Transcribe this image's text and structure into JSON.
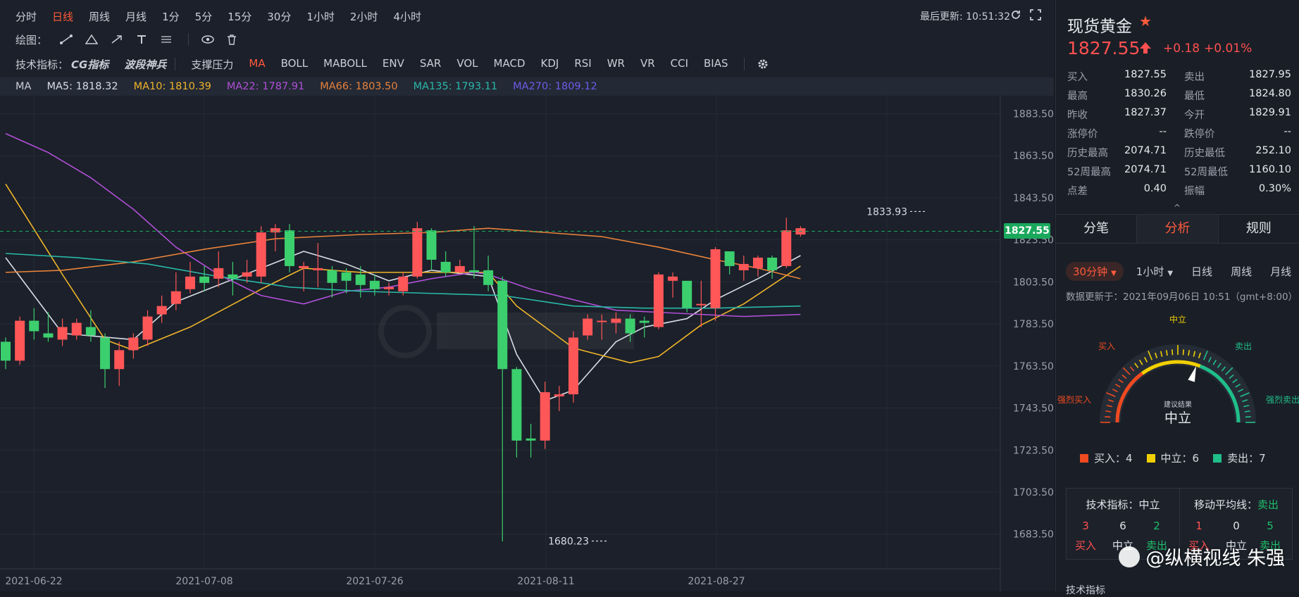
{
  "toolbar": {
    "periods": [
      "分时",
      "日线",
      "周线",
      "月线",
      "1分",
      "5分",
      "15分",
      "30分",
      "1小时",
      "2小时",
      "4小时"
    ],
    "active_period": 1,
    "last_update_label": "最后更新: 10:51:32"
  },
  "drawing": {
    "label": "绘图："
  },
  "indicators": {
    "label": "技术指标：",
    "cg": "CG指标",
    "wave": "波段神兵",
    "items": [
      "支撑压力",
      "MA",
      "BOLL",
      "MABOLL",
      "ENV",
      "SAR",
      "VOL",
      "MACD",
      "KDJ",
      "RSI",
      "WR",
      "VR",
      "CCI",
      "BIAS"
    ],
    "active": "MA"
  },
  "ma_bar": {
    "prefix": "MA",
    "items": [
      {
        "label": "MA5: 1818.32",
        "color": "#d8dde6"
      },
      {
        "label": "MA10: 1810.39",
        "color": "#f0b429"
      },
      {
        "label": "MA22: 1787.91",
        "color": "#b04fd6"
      },
      {
        "label": "MA66: 1803.50",
        "color": "#e8823a"
      },
      {
        "label": "MA135: 1793.11",
        "color": "#2ab8a8"
      },
      {
        "label": "MA270: 1809.12",
        "color": "#6c5ce7"
      }
    ]
  },
  "chart_data": {
    "type": "candlestick",
    "y_ticks": [
      "1883.50",
      "1863.50",
      "1843.50",
      "1823.50",
      "1803.50",
      "1783.50",
      "1763.50",
      "1743.50",
      "1723.50",
      "1703.50",
      "1683.50"
    ],
    "ylim": [
      1667,
      1892
    ],
    "x_labels": [
      "2021-06-22",
      "2021-07-08",
      "2021-07-26",
      "2021-08-11",
      "2021-08-27"
    ],
    "last_price": "1827.55",
    "high_label": "1833.93",
    "low_label": "1680.23",
    "candles": [
      [
        1775,
        1766,
        1777,
        1762
      ],
      [
        1766,
        1785,
        1787,
        1764
      ],
      [
        1785,
        1780,
        1791,
        1776
      ],
      [
        1779,
        1777,
        1789,
        1775
      ],
      [
        1776,
        1782,
        1786,
        1773
      ],
      [
        1778,
        1784,
        1786,
        1776
      ],
      [
        1782,
        1778,
        1790,
        1775
      ],
      [
        1777,
        1762,
        1779,
        1753
      ],
      [
        1762,
        1771,
        1775,
        1754
      ],
      [
        1771,
        1777,
        1779,
        1767
      ],
      [
        1776,
        1787,
        1790,
        1773
      ],
      [
        1788,
        1792,
        1797,
        1784
      ],
      [
        1793,
        1799,
        1808,
        1790
      ],
      [
        1800,
        1806,
        1813,
        1798
      ],
      [
        1806,
        1803,
        1811,
        1799
      ],
      [
        1805,
        1810,
        1818,
        1801
      ],
      [
        1807,
        1805,
        1813,
        1797
      ],
      [
        1806,
        1808,
        1814,
        1803
      ],
      [
        1806,
        1827,
        1830,
        1803
      ],
      [
        1827,
        1829,
        1831,
        1818
      ],
      [
        1828,
        1811,
        1831,
        1808
      ],
      [
        1810,
        1811,
        1813,
        1799
      ],
      [
        1809,
        1810,
        1822,
        1801
      ],
      [
        1809,
        1803,
        1811,
        1796
      ],
      [
        1808,
        1804,
        1810,
        1798
      ],
      [
        1807,
        1802,
        1811,
        1796
      ],
      [
        1804,
        1800,
        1807,
        1797
      ],
      [
        1800,
        1801,
        1803,
        1797
      ],
      [
        1799,
        1806,
        1808,
        1797
      ],
      [
        1806,
        1829,
        1832,
        1805
      ],
      [
        1828,
        1814,
        1829,
        1809
      ],
      [
        1813,
        1808,
        1818,
        1806
      ],
      [
        1808,
        1811,
        1814,
        1807
      ],
      [
        1809,
        1808,
        1830,
        1805
      ],
      [
        1809,
        1802,
        1816,
        1799
      ],
      [
        1804,
        1762,
        1806,
        1680
      ],
      [
        1762,
        1728,
        1763,
        1720
      ],
      [
        1729,
        1728,
        1736,
        1720
      ],
      [
        1728,
        1751,
        1756,
        1724
      ],
      [
        1749,
        1750,
        1754,
        1742
      ],
      [
        1750,
        1777,
        1780,
        1746
      ],
      [
        1778,
        1786,
        1788,
        1776
      ],
      [
        1785,
        1785,
        1788,
        1776
      ],
      [
        1784,
        1786,
        1789,
        1779
      ],
      [
        1786,
        1779,
        1788,
        1775
      ],
      [
        1785,
        1784,
        1787,
        1777
      ],
      [
        1782,
        1807,
        1808,
        1781
      ],
      [
        1804,
        1806,
        1808,
        1796
      ],
      [
        1804,
        1791,
        1803,
        1789
      ],
      [
        1793,
        1793,
        1804,
        1782
      ],
      [
        1791,
        1819,
        1820,
        1785
      ],
      [
        1818,
        1811,
        1818,
        1807
      ],
      [
        1809,
        1812,
        1816,
        1804
      ],
      [
        1810,
        1815,
        1816,
        1806
      ],
      [
        1815,
        1809,
        1816,
        1805
      ],
      [
        1811,
        1828,
        1834,
        1810
      ],
      [
        1826,
        1829,
        1830,
        1825
      ]
    ],
    "ma_series": [
      {
        "name": "MA5",
        "color": "#d8dde6",
        "points": [
          [
            0,
            1815
          ],
          [
            4,
            1779
          ],
          [
            9,
            1776
          ],
          [
            12,
            1794
          ],
          [
            18,
            1810
          ],
          [
            21,
            1818
          ],
          [
            24,
            1812
          ],
          [
            27,
            1804
          ],
          [
            30,
            1809
          ],
          [
            34,
            1806
          ],
          [
            36,
            1769
          ],
          [
            38,
            1747
          ],
          [
            40,
            1752
          ],
          [
            43,
            1775
          ],
          [
            45,
            1782
          ],
          [
            48,
            1786
          ],
          [
            50,
            1795
          ],
          [
            53,
            1805
          ],
          [
            56,
            1816
          ]
        ]
      },
      {
        "name": "MA10",
        "color": "#f0b429",
        "points": [
          [
            0,
            1850
          ],
          [
            4,
            1807
          ],
          [
            7,
            1776
          ],
          [
            9,
            1771
          ],
          [
            13,
            1782
          ],
          [
            18,
            1800
          ],
          [
            21,
            1810
          ],
          [
            25,
            1808
          ],
          [
            30,
            1808
          ],
          [
            34,
            1808
          ],
          [
            36,
            1792
          ],
          [
            40,
            1772
          ],
          [
            44,
            1765
          ],
          [
            46,
            1768
          ],
          [
            49,
            1783
          ],
          [
            52,
            1793
          ],
          [
            56,
            1811
          ]
        ]
      },
      {
        "name": "MA22",
        "color": "#b04fd6",
        "points": [
          [
            0,
            1874
          ],
          [
            3,
            1865
          ],
          [
            6,
            1853
          ],
          [
            9,
            1838
          ],
          [
            12,
            1820
          ],
          [
            15,
            1807
          ],
          [
            18,
            1797
          ],
          [
            21,
            1793
          ],
          [
            24,
            1799
          ],
          [
            27,
            1801
          ],
          [
            30,
            1805
          ],
          [
            33,
            1808
          ],
          [
            34,
            1807
          ],
          [
            37,
            1800
          ],
          [
            40,
            1795
          ],
          [
            43,
            1790
          ],
          [
            46,
            1789
          ],
          [
            49,
            1788
          ],
          [
            52,
            1787
          ],
          [
            56,
            1788
          ]
        ]
      },
      {
        "name": "MA66",
        "color": "#e8823a",
        "points": [
          [
            0,
            1808
          ],
          [
            4,
            1809
          ],
          [
            9,
            1813
          ],
          [
            14,
            1819
          ],
          [
            19,
            1824
          ],
          [
            25,
            1826
          ],
          [
            30,
            1827
          ],
          [
            34,
            1829
          ],
          [
            38,
            1827
          ],
          [
            42,
            1825
          ],
          [
            46,
            1820
          ],
          [
            50,
            1814
          ],
          [
            53,
            1810
          ],
          [
            56,
            1805
          ]
        ]
      },
      {
        "name": "MA135",
        "color": "#2ab8a8",
        "points": [
          [
            0,
            1817
          ],
          [
            5,
            1815
          ],
          [
            10,
            1812
          ],
          [
            15,
            1806
          ],
          [
            20,
            1801
          ],
          [
            25,
            1799
          ],
          [
            30,
            1798
          ],
          [
            35,
            1797
          ],
          [
            40,
            1792
          ],
          [
            45,
            1791
          ],
          [
            50,
            1791
          ],
          [
            56,
            1792
          ]
        ]
      }
    ]
  },
  "instrument": {
    "name": "现货黄金",
    "price": "1827.55",
    "change": "+0.18",
    "change_pct": "+0.01%"
  },
  "stats": [
    {
      "l1": "买入",
      "v1": "1827.55",
      "l2": "卖出",
      "v2": "1827.95"
    },
    {
      "l1": "最高",
      "v1": "1830.26",
      "l2": "最低",
      "v2": "1824.80"
    },
    {
      "l1": "昨收",
      "v1": "1827.37",
      "l2": "今开",
      "v2": "1829.91"
    },
    {
      "l1": "涨停价",
      "v1": "--",
      "l2": "跌停价",
      "v2": "--"
    },
    {
      "l1": "历史最高",
      "v1": "2074.71",
      "l2": "历史最低",
      "v2": "252.10"
    },
    {
      "l1": "52周最高",
      "v1": "2074.71",
      "l2": "52周最低",
      "v2": "1160.10"
    },
    {
      "l1": "点差",
      "v1": "0.40",
      "l2": "振幅",
      "v2": "0.30%"
    }
  ],
  "tabs": [
    "分笔",
    "分析",
    "规则"
  ],
  "analysis": {
    "periods": [
      "30分钟",
      "1小时",
      "日线",
      "周线",
      "月线"
    ],
    "data_time": "数据更新于：2021年09月06日 10:51（gmt+8:00）",
    "gauge": {
      "labels": [
        "强烈买入",
        "买入",
        "中立",
        "卖出",
        "强烈卖出"
      ],
      "sub_label": "建议结果",
      "result": "中立",
      "needle_value": 0.6
    },
    "legend": [
      {
        "label": "买入：4",
        "color": "#f04a20"
      },
      {
        "label": "中立：6",
        "color": "#f2d000"
      },
      {
        "label": "卖出：7",
        "color": "#1fbf8a"
      }
    ],
    "tech": {
      "title": "技术指标：",
      "result": "中立",
      "counts": [
        "3",
        "6",
        "2"
      ],
      "words": [
        "买入",
        "中立",
        "卖出"
      ]
    },
    "ma": {
      "title": "移动平均线：",
      "result": "卖出",
      "counts": [
        "1",
        "0",
        "5"
      ],
      "words": [
        "买入",
        "中立",
        "卖出"
      ]
    },
    "bottom_label": "技术指标"
  },
  "watermark": "@纵横视线 朱强"
}
